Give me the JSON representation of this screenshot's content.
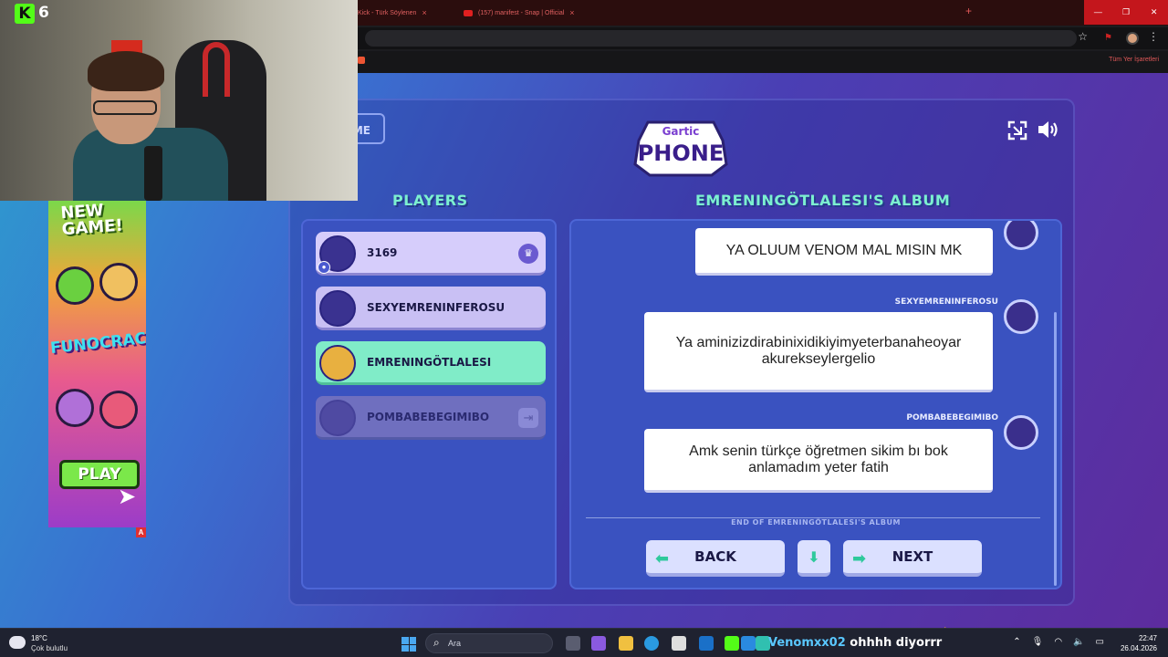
{
  "browser": {
    "tabs": [
      {
        "label": "Kick - Türk Söylenen",
        "close": "×"
      },
      {
        "label": "(157) manifest - Snap | Official",
        "close": "×"
      }
    ],
    "new_tab": "+",
    "window_controls": [
      "—",
      "❐",
      "✕"
    ],
    "bookmarks_folder": "Tüm Yer İşaretleri"
  },
  "stream_overlay": {
    "platform_logo": "K",
    "viewer_count": "6"
  },
  "ad": {
    "headline": "NEW GAME!",
    "brand": "FUNOCRACY",
    "cta": "PLAY",
    "adchoices": "A"
  },
  "game": {
    "home_label": "ME",
    "logo_top": "Gartic",
    "logo_main": "PHONE",
    "players_title": "PLAYERS",
    "album_title": "EMRENINGÖTLALESI'S ALBUM",
    "players": [
      {
        "name": "3169",
        "state": "host"
      },
      {
        "name": "SEXYEMRENINFEROSU",
        "state": "normal"
      },
      {
        "name": "EMRENINGÖTLALESI",
        "state": "active"
      },
      {
        "name": "POMBABEBEGIMIBO",
        "state": "left"
      }
    ],
    "messages": [
      {
        "author": "3169",
        "text": "YA OLUUM VENOM MAL MISIN MK"
      },
      {
        "author": "SEXYEMRENINFEROSU",
        "text": "Ya aminizizdirabinixidikiyimyeterbanaheoyar akurekseylergelio"
      },
      {
        "author": "POMBABEBEGIMIBO",
        "text": "Amk senin türkçe öğretmen sikim bı bok anlamadım yeter fatih"
      }
    ],
    "end_label": "END OF EMRENINGÖTLALESI'S ALBUM",
    "back_label": "BACK",
    "next_label": "NEXT"
  },
  "taskbar": {
    "weather_temp": "18°C",
    "weather_desc": "Çok bulutlu",
    "search_placeholder": "Ara",
    "chat_user": "Venomxx02",
    "chat_message": "ohhhh diyorrr",
    "time": "22:47",
    "date": "26.04.2026"
  },
  "colors": {
    "accent_teal": "#7cf0d0",
    "panel_blue": "#3a52c0",
    "kick_green": "#53fc18"
  }
}
